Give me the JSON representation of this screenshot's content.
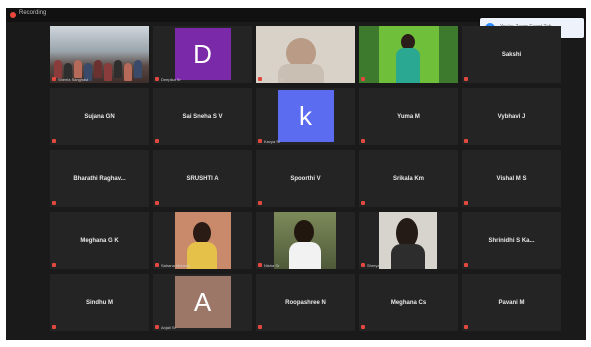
{
  "topbar": {
    "recording_label": "Recording"
  },
  "notice": {
    "text": "You're Zoom Event Tab"
  },
  "colors": {
    "active_speaker_border": "#c8d84a",
    "muted_mic": "#e2483d",
    "tile_bg": "#242424"
  },
  "tiles": [
    {
      "name": "",
      "type": "video",
      "scene": "classroom",
      "caption": "Sheela Sanghavi"
    },
    {
      "name": "",
      "type": "avatar",
      "letter": "D",
      "avatar_color": "#7a2aa8",
      "caption": "Deepika Sr"
    },
    {
      "name": "",
      "type": "video",
      "scene": "webcam",
      "caption": "Harshini Sr"
    },
    {
      "name": "",
      "type": "video",
      "scene": "green",
      "caption": "",
      "active": true
    },
    {
      "name": "Sakshi",
      "type": "name"
    },
    {
      "name": "Sujana GN",
      "type": "name"
    },
    {
      "name": "Sai Sneha S V",
      "type": "name"
    },
    {
      "name": "",
      "type": "avatar",
      "letter": "k",
      "avatar_color": "#5b6cf0",
      "caption": "Kavya Sr"
    },
    {
      "name": "Yuma M",
      "type": "name"
    },
    {
      "name": "Vybhavi J",
      "type": "name"
    },
    {
      "name": "Bharathi Raghav...",
      "type": "name"
    },
    {
      "name": "SRUSHTI A",
      "type": "name"
    },
    {
      "name": "Spoorthi V",
      "type": "name"
    },
    {
      "name": "Srikala Km",
      "type": "name"
    },
    {
      "name": "Vishal M S",
      "type": "name"
    },
    {
      "name": "Meghana G K",
      "type": "name"
    },
    {
      "name": "",
      "type": "video",
      "scene": "brick",
      "caption": "Sahana Mahesh"
    },
    {
      "name": "",
      "type": "video",
      "scene": "outdoor",
      "caption": "Nisha Sr"
    },
    {
      "name": "",
      "type": "video",
      "scene": "dark",
      "caption": "Shreya Sr"
    },
    {
      "name": "Shrinidhi S Ka...",
      "type": "name"
    },
    {
      "name": "Sindhu M",
      "type": "name"
    },
    {
      "name": "",
      "type": "avatar",
      "letter": "A",
      "avatar_color": "#9c7667",
      "caption": "Anjali Sr"
    },
    {
      "name": "Roopashree N",
      "type": "name"
    },
    {
      "name": "Meghana Cs",
      "type": "name"
    },
    {
      "name": "Pavani M",
      "type": "name"
    }
  ]
}
